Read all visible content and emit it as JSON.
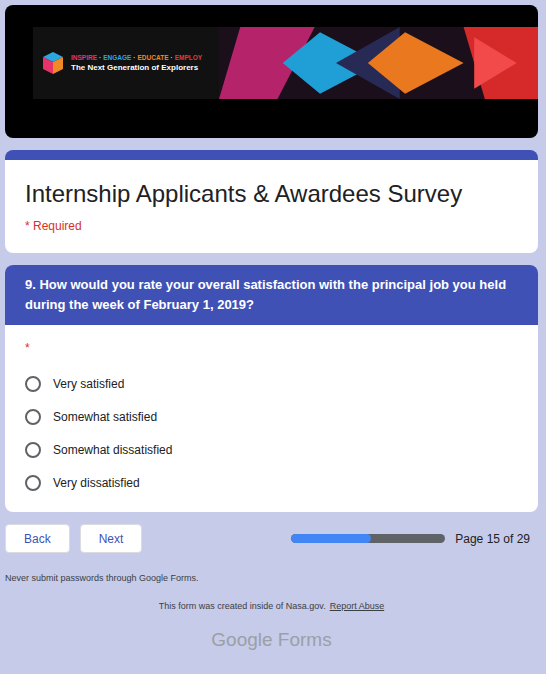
{
  "banner": {
    "tagline": [
      {
        "text": "INSPIRE",
        "color": "#e8336a"
      },
      {
        "text": "ENGAGE",
        "color": "#2ba8e0"
      },
      {
        "text": "EDUCATE",
        "color": "#f08a24"
      },
      {
        "text": "EMPLOY",
        "color": "#e53935"
      }
    ],
    "separator": "·",
    "subtitle": "The Next Generation of Explorers"
  },
  "form": {
    "title": "Internship Applicants & Awardees Survey",
    "required_note": "* Required"
  },
  "question": {
    "text": "9. How would you rate your overall satisfaction with the principal job you held during the week of February 1, 2019?",
    "required_mark": "*",
    "options": [
      {
        "label": "Very satisfied",
        "selected": false
      },
      {
        "label": "Somewhat satisfied",
        "selected": false
      },
      {
        "label": "Somewhat dissatisfied",
        "selected": false
      },
      {
        "label": "Very dissatisfied",
        "selected": false
      }
    ]
  },
  "nav": {
    "buttons": [
      "Back",
      "Next"
    ],
    "progress": {
      "level": 0.52,
      "label": "Page 15 of 29"
    }
  },
  "footer": {
    "warning": "Never submit passwords through Google Forms.",
    "created": "This form was created inside of Nasa.gov.",
    "report": "Report Abuse",
    "brand": "Google Forms"
  }
}
